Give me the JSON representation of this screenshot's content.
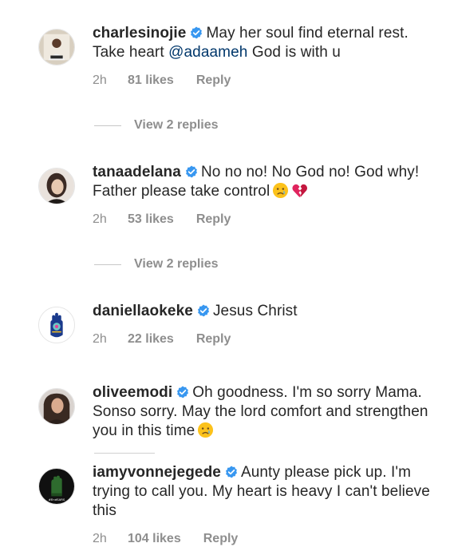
{
  "comments": [
    {
      "username": "charlesinojie",
      "text_before": "May her soul find eternal rest. Take heart ",
      "mention": "@adaameh",
      "text_after": " God is with u",
      "time": "2h",
      "likes": "81 likes",
      "reply": "Reply",
      "view_replies": "View 2 replies"
    },
    {
      "username": "tanaadelana",
      "text": "No no no! No God no! God why! Father please take control",
      "emojis": [
        "crying-face-emoji",
        "broken-heart-emoji"
      ],
      "time": "2h",
      "likes": "53 likes",
      "reply": "Reply",
      "view_replies": "View 2 replies"
    },
    {
      "username": "daniellaokeke",
      "text": "Jesus Christ",
      "time": "2h",
      "likes": "22 likes",
      "reply": "Reply"
    },
    {
      "username": "oliveemodi",
      "text": "Oh goodness. I'm so sorry Mama. Sonso sorry. May the lord comfort and strengthen you in this time",
      "emojis": [
        "crying-face-emoji"
      ]
    },
    {
      "username": "iamyvonnejegede",
      "text": "Aunty please pick up. I'm trying to call you. My heart is heavy I can't believe this",
      "time": "2h",
      "likes": "104 likes",
      "reply": "Reply"
    }
  ],
  "colors": {
    "text": "#262626",
    "secondary": "#8e8e8e",
    "mention": "#00376b",
    "verified": "#3897f0"
  }
}
